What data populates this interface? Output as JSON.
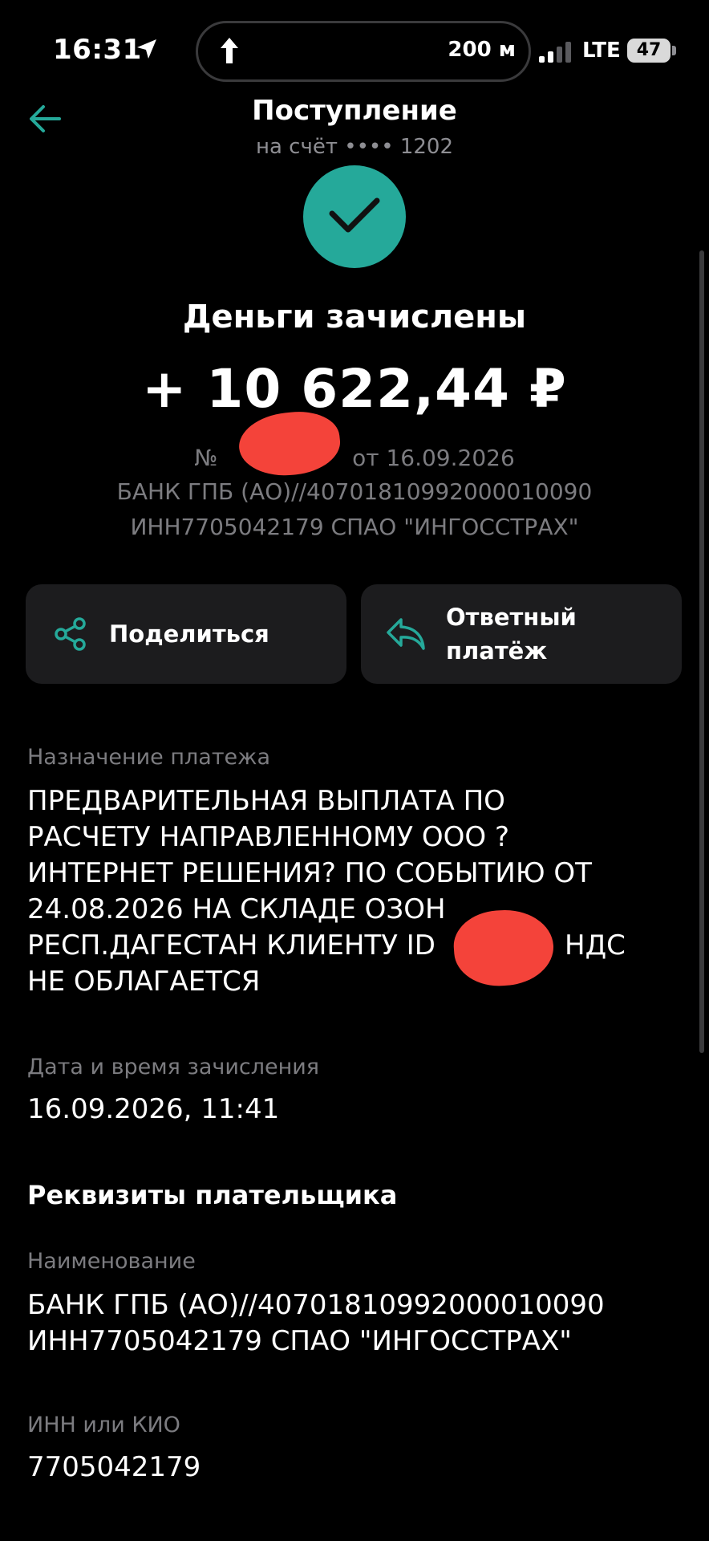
{
  "status_bar": {
    "time": "16:31",
    "distance": "200 м",
    "network": "LTE",
    "battery": "47",
    "icons": [
      "location-arrow-icon",
      "navigation-arrow-icon",
      "signal-icon",
      "battery-icon"
    ]
  },
  "header": {
    "title": "Поступление",
    "subtitle": "на счёт •••• 1202",
    "back_icon": "arrow-left-icon"
  },
  "success": {
    "title": "Деньги зачислены",
    "amount": "+ 10 622,44 ₽",
    "doc_prefix": "№",
    "doc_date": "от 16.09.2026",
    "payer_line1": "БАНК ГПБ (АО)//40701810992000010090",
    "payer_line2": "ИНН7705042179 СПАО \"ИНГОССТРАХ\"",
    "accent_color": "#25a99a"
  },
  "actions": {
    "share_label": "Поделиться",
    "reply_label_line1": "Ответный",
    "reply_label_line2": "платёж"
  },
  "details": {
    "purpose_label": "Назначение платежа",
    "purpose_lines": [
      "ПРЕДВАРИТЕЛЬНАЯ ВЫПЛАТА ПО",
      "РАСЧЕТУ НАПРАВЛЕННОМУ ООО ?",
      "ИНТЕРНЕТ РЕШЕНИЯ? ПО СОБЫТИЮ ОТ",
      "24.08.2026 НА СКЛАДЕ ОЗОН",
      "РЕСП.ДАГЕСТАН КЛИЕНТУ ID",
      "НДС",
      "НЕ ОБЛАГАЕТСЯ"
    ],
    "datetime_label": "Дата и время зачисления",
    "datetime_value": "16.09.2026, 11:41"
  },
  "payer": {
    "section_title": "Реквизиты плательщика",
    "name_label": "Наименование",
    "name_line1": "БАНК ГПБ (АО)//40701810992000010090",
    "name_line2": "ИНН7705042179 СПАО \"ИНГОССТРАХ\"",
    "inn_label": "ИНН или КИО",
    "inn_value": "7705042179"
  }
}
